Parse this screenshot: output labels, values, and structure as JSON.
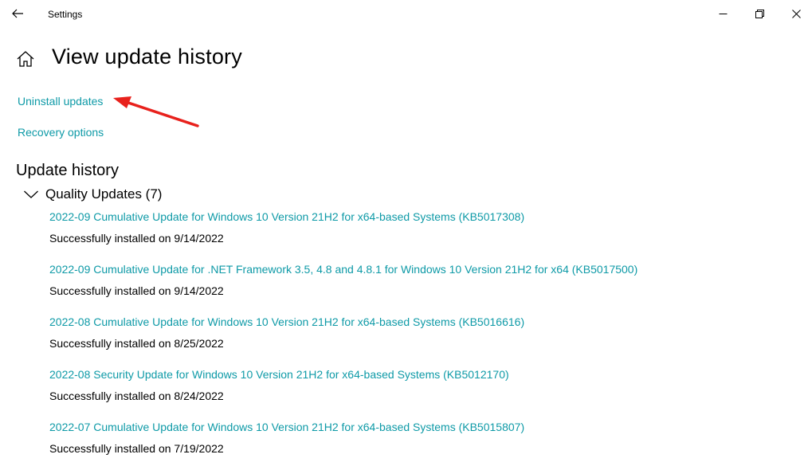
{
  "titlebar": {
    "title": "Settings"
  },
  "page": {
    "title": "View update history"
  },
  "links": {
    "uninstall": "Uninstall updates",
    "recovery": "Recovery options"
  },
  "history": {
    "title": "Update history",
    "group_label": "Quality Updates (7)",
    "updates": [
      {
        "name": "2022-09 Cumulative Update for Windows 10 Version 21H2 for x64-based Systems (KB5017308)",
        "status": "Successfully installed on 9/14/2022"
      },
      {
        "name": "2022-09 Cumulative Update for .NET Framework 3.5, 4.8 and 4.8.1 for Windows 10 Version 21H2 for x64 (KB5017500)",
        "status": "Successfully installed on 9/14/2022"
      },
      {
        "name": "2022-08 Cumulative Update for Windows 10 Version 21H2 for x64-based Systems (KB5016616)",
        "status": "Successfully installed on 8/25/2022"
      },
      {
        "name": "2022-08 Security Update for Windows 10 Version 21H2 for x64-based Systems (KB5012170)",
        "status": "Successfully installed on 8/24/2022"
      },
      {
        "name": "2022-07 Cumulative Update for Windows 10 Version 21H2 for x64-based Systems (KB5015807)",
        "status": "Successfully installed on 7/19/2022"
      }
    ]
  },
  "colors": {
    "link": "#0e9aa7",
    "annotation_arrow": "#e8211c"
  },
  "icons": {
    "back": "back-arrow-icon",
    "home": "home-icon",
    "minimize": "minimize-icon",
    "maximize": "restore-icon",
    "close": "close-icon",
    "expand": "chevron-down-icon"
  }
}
